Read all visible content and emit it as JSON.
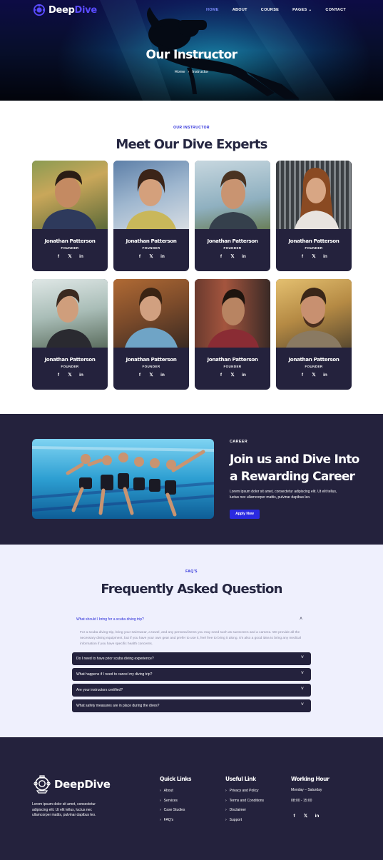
{
  "nav": {
    "brand_a": "Deep",
    "brand_b": "Dive",
    "links": [
      "HOME",
      "ABOUT",
      "COURSE",
      "PAGES",
      "CONTACT"
    ],
    "accent": "#5a4bff"
  },
  "hero": {
    "title": "Our Instructor",
    "crumb_home": "Home",
    "crumb_current": "Instructor"
  },
  "instructors": {
    "eyebrow": "OUR INSTRUCTOR",
    "title": "Meet Our Dive Experts",
    "cards": [
      {
        "name": "Jonathan Patterson",
        "role": "FOUNDER"
      },
      {
        "name": "Jonathan Patterson",
        "role": "FOUNDER"
      },
      {
        "name": "Jonathan Patterson",
        "role": "FOUNDER"
      },
      {
        "name": "Jonathan Patterson",
        "role": "FOUNDER"
      },
      {
        "name": "Jonathan Patterson",
        "role": "FOUNDER"
      },
      {
        "name": "Jonathan Patterson",
        "role": "FOUNDER"
      },
      {
        "name": "Jonathan Patterson",
        "role": "FOUNDER"
      },
      {
        "name": "Jonathan Patterson",
        "role": "FOUNDER"
      }
    ],
    "social_icons": [
      "facebook-icon",
      "x-icon",
      "linkedin-icon"
    ]
  },
  "career": {
    "tag": "CAREER",
    "title": "Join us and Dive Into a Rewarding Career",
    "desc": "Lorem ipsum dolor sit amet, consectetur adipiscing elit. Ut elit tellus, luctus nec ullamcorper mattis, pulvinar dapibus leo.",
    "button": "Apply Now"
  },
  "faq": {
    "eyebrow": "FAQ'S",
    "title": "Frequently Asked Question",
    "open_question": "What should I bring for a scuba diving trip?",
    "open_answer": "For a scuba diving trip, bring your swimwear, a towel, and any personal items you may need such as sunscreen and a camera. We provide all the necessary diving equipment, but if you have your own gear and prefer to use it, feel free to bring it along. It's also a good idea to bring any medical information if you have specific health concerns.",
    "items": [
      "Do I need to have prior scuba diving experience?",
      "What happens if I need to cancel my diving trip?",
      "Are your instructors certified?",
      "What safety measures are in place during the dives?"
    ]
  },
  "footer": {
    "brand": "DeepDive",
    "about": "Lorem ipsum dolor sit amet, consectetur adipiscing elit. Ut elit tellus, luctus nec ullamcorper mattis, pulvinar dapibus leo.",
    "quick_title": "Quick Links",
    "quick_links": [
      "About",
      "Services",
      "Case Studies",
      "FAQ's"
    ],
    "useful_title": "Useful Link",
    "useful_links": [
      "Privacy and Policy",
      "Terms and Conditions",
      "Disclaimer",
      "Support"
    ],
    "hours_title": "Working Hour",
    "hours_days": "Monday – Saturday",
    "hours_time": "08:00 - 15:00"
  }
}
